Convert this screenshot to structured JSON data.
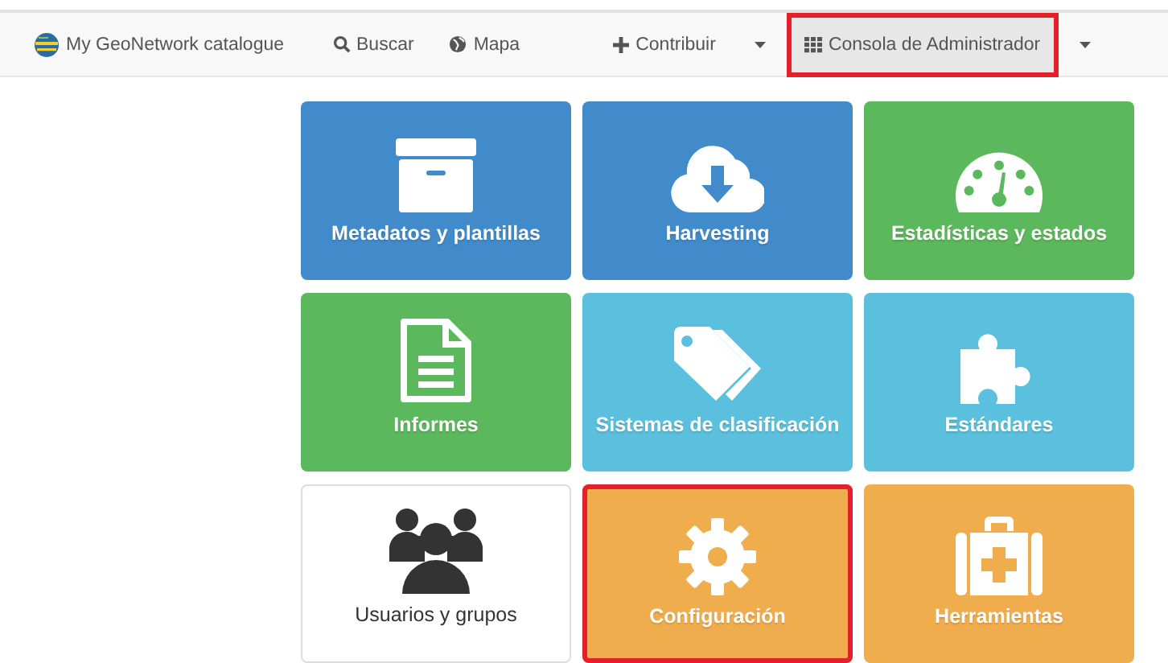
{
  "navbar": {
    "brand": "My GeoNetwork catalogue",
    "items": [
      {
        "kind": "link",
        "label": "Buscar",
        "selected": false,
        "highlighted": false
      },
      {
        "kind": "link",
        "label": "Mapa",
        "selected": false,
        "highlighted": false
      },
      {
        "kind": "link",
        "label": "Contribuir",
        "selected": false,
        "highlighted": false
      },
      {
        "kind": "caret",
        "selected": false,
        "highlighted": false
      },
      {
        "kind": "link",
        "label": "Consola de Administrador",
        "selected": true,
        "highlighted": true
      },
      {
        "kind": "caret",
        "selected": false,
        "highlighted": false
      }
    ]
  },
  "tiles": [
    {
      "label": "Metadatos y plantillas",
      "color": "#428bca",
      "highlighted": false
    },
    {
      "label": "Harvesting",
      "color": "#428bca",
      "highlighted": false
    },
    {
      "label": "Estadísticas y estados",
      "color": "#5cb85c",
      "highlighted": false
    },
    {
      "label": "Informes",
      "color": "#5cb85c",
      "highlighted": false
    },
    {
      "label": "Sistemas de clasificación",
      "color": "#5bc0de",
      "highlighted": false
    },
    {
      "label": "Estándares",
      "color": "#5bc0de",
      "highlighted": false
    },
    {
      "label": "Usuarios y grupos",
      "color": "#ffffff",
      "highlighted": false
    },
    {
      "label": "Configuración",
      "color": "#f0ad4e",
      "highlighted": true
    },
    {
      "label": "Herramientas",
      "color": "#f0ad4e",
      "highlighted": false
    }
  ]
}
